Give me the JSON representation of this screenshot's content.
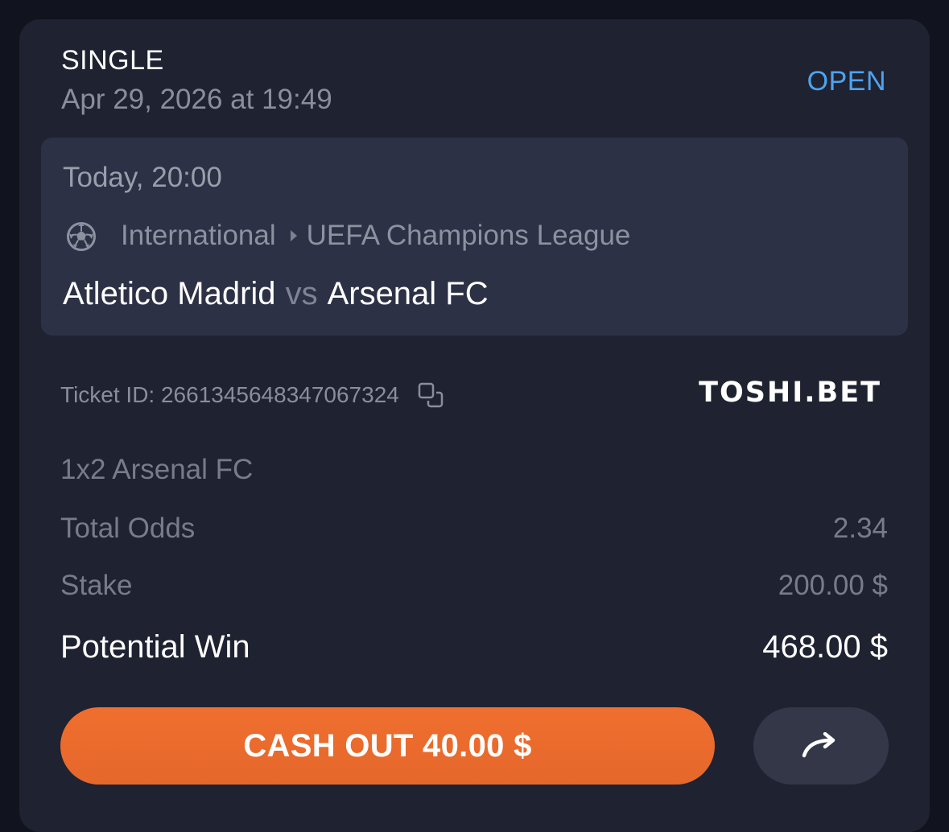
{
  "bet": {
    "type": "SINGLE",
    "placed_at": "Apr 29, 2026 at 19:49",
    "status": "OPEN",
    "status_color": "#4ea3ee"
  },
  "event": {
    "time": "Today, 20:00",
    "sport_icon": "soccer-ball-icon",
    "region": "International",
    "league": "UEFA Champions League",
    "home_team": "Atletico Madrid",
    "vs": "vs",
    "away_team": "Arsenal FC"
  },
  "ticket": {
    "label": "Ticket ID: 2661345648347067324",
    "copy_icon": "copy-icon"
  },
  "brand": "TOSHI.BET",
  "selection": "1x2 Arsenal FC",
  "summary": {
    "odds_label": "Total Odds",
    "odds_value": "2.34",
    "stake_label": "Stake",
    "stake_value": "200.00 $",
    "win_label": "Potential Win",
    "win_value": "468.00 $"
  },
  "actions": {
    "cashout_label": "CASH OUT 40.00 $",
    "cashout_color": "#ec6c2d",
    "share_icon": "share-arrow-icon"
  }
}
